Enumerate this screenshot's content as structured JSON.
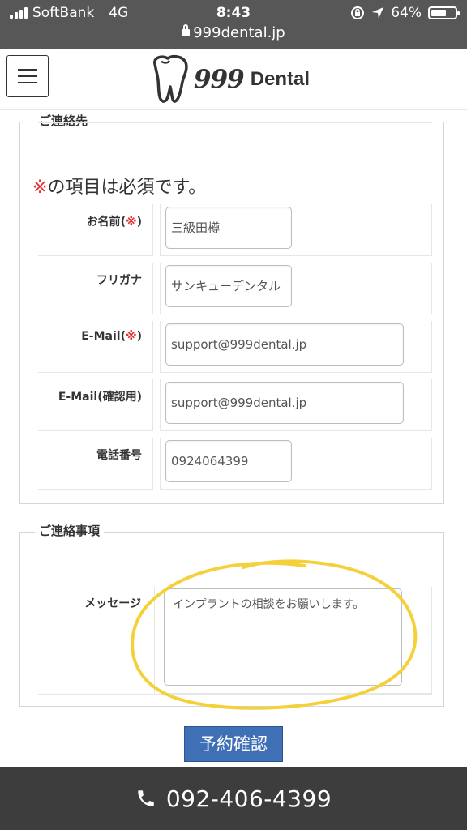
{
  "status_bar": {
    "carrier": "SoftBank",
    "network": "4G",
    "time": "8:43",
    "battery": "64%",
    "battery_level": 0.64,
    "url": "999dental.jp"
  },
  "header": {
    "menu_icon": "hamburger-menu-icon",
    "logo_number": "999",
    "logo_word": "Dental"
  },
  "contact_section": {
    "legend": "ご連絡先",
    "required_mark": "※",
    "required_note": "の項目は必須です。",
    "fields": [
      {
        "label": "お名前",
        "required": true,
        "value": "三級田樽"
      },
      {
        "label": "フリガナ",
        "required": false,
        "value": "サンキューデンタル"
      },
      {
        "label": "E-Mail",
        "required": true,
        "value": "support@999dental.jp"
      },
      {
        "label": "E-Mail(確認用)",
        "required": false,
        "value": "support@999dental.jp"
      },
      {
        "label": "電話番号",
        "required": false,
        "value": "0924064399"
      }
    ]
  },
  "message_section": {
    "legend": "ご連絡事項",
    "label": "メッセージ",
    "value": "インプラントの相談をお願いします。"
  },
  "submit_label": "予約確認",
  "footer": {
    "phone": "092-406-4399"
  },
  "colors": {
    "status_bar_bg": "#575757",
    "required_red": "#e0302c",
    "button_blue": "#3f6fb5",
    "footer_bg": "#3d3d3d",
    "highlight_yellow": "#f4d13a"
  }
}
